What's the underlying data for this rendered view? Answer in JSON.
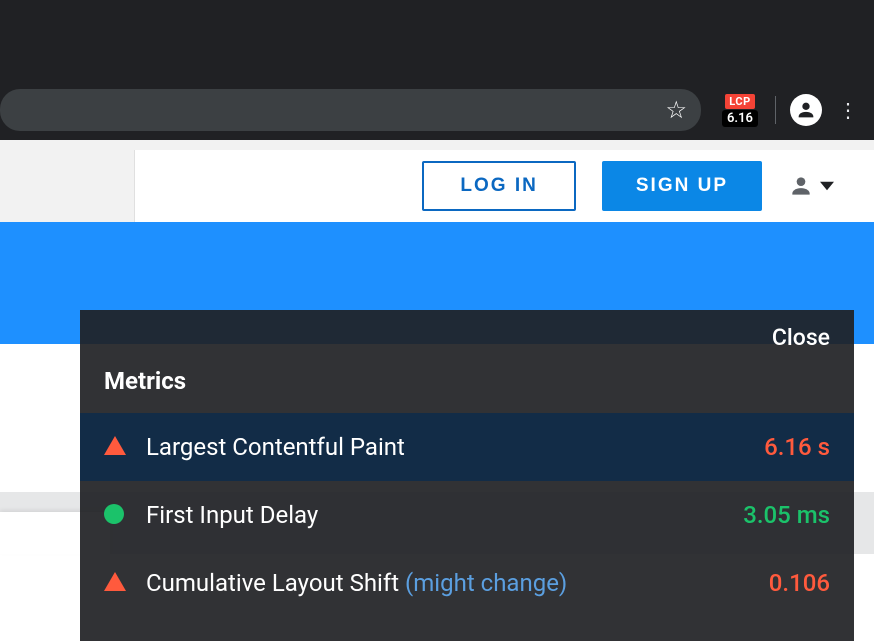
{
  "browser": {
    "extension": {
      "tag": "LCP",
      "value": "6.16"
    }
  },
  "site": {
    "login": "LOG IN",
    "signup": "SIGN UP"
  },
  "overlay": {
    "close": "Close",
    "title": "Metrics",
    "rows": [
      {
        "label": "Largest Contentful Paint",
        "suffix": "",
        "value": "6.16 s",
        "status": "bad",
        "icon": "triangle"
      },
      {
        "label": "First Input Delay",
        "suffix": "",
        "value": "3.05 ms",
        "status": "good",
        "icon": "circle"
      },
      {
        "label": "Cumulative Layout Shift",
        "suffix": "(might change)",
        "value": "0.106",
        "status": "bad",
        "icon": "triangle"
      }
    ]
  },
  "colors": {
    "bad": "#ff5a3d",
    "good": "#1bc26a",
    "accent": "#0b87e6"
  }
}
